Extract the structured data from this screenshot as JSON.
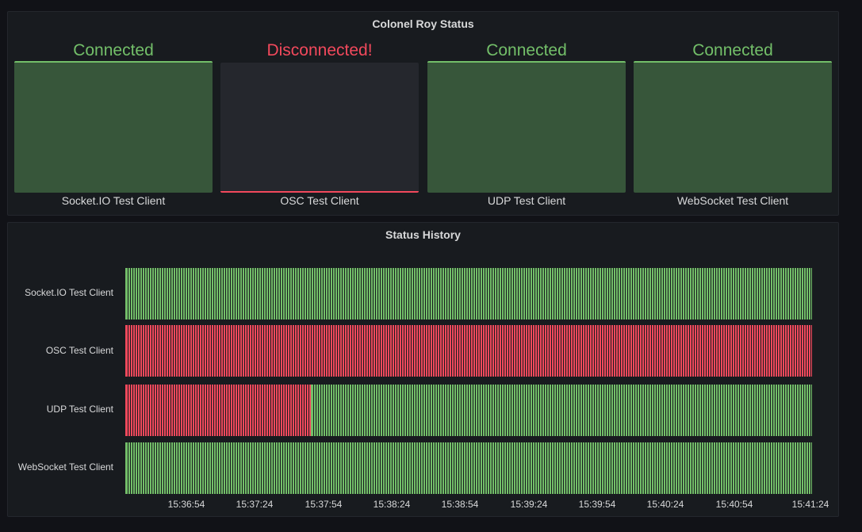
{
  "status_panel": {
    "title": "Colonel Roy Status",
    "clients": [
      {
        "name": "Socket.IO Test Client",
        "state": "Connected",
        "ok": true
      },
      {
        "name": "OSC Test Client",
        "state": "Disconnected!",
        "ok": false
      },
      {
        "name": "UDP Test Client",
        "state": "Connected",
        "ok": true
      },
      {
        "name": "WebSocket Test Client",
        "state": "Connected",
        "ok": true
      }
    ]
  },
  "history_panel": {
    "title": "Status History",
    "rows": [
      {
        "name": "Socket.IO Test Client",
        "segments": [
          {
            "state": "connected",
            "from": 0,
            "to": 1
          }
        ]
      },
      {
        "name": "OSC Test Client",
        "segments": [
          {
            "state": "disconnected",
            "from": 0,
            "to": 1
          }
        ]
      },
      {
        "name": "UDP Test Client",
        "segments": [
          {
            "state": "disconnected",
            "from": 0,
            "to": 0.27
          },
          {
            "state": "connected",
            "from": 0.27,
            "to": 1
          }
        ]
      },
      {
        "name": "WebSocket Test Client",
        "segments": [
          {
            "state": "connected",
            "from": 0,
            "to": 1
          }
        ]
      }
    ],
    "time_ticks": [
      "15:36:54",
      "15:37:24",
      "15:37:54",
      "15:38:24",
      "15:38:54",
      "15:39:24",
      "15:39:54",
      "15:40:24",
      "15:40:54",
      "15:41:24"
    ]
  },
  "colors": {
    "connected": "#73bf69",
    "disconnected": "#f2495c"
  }
}
